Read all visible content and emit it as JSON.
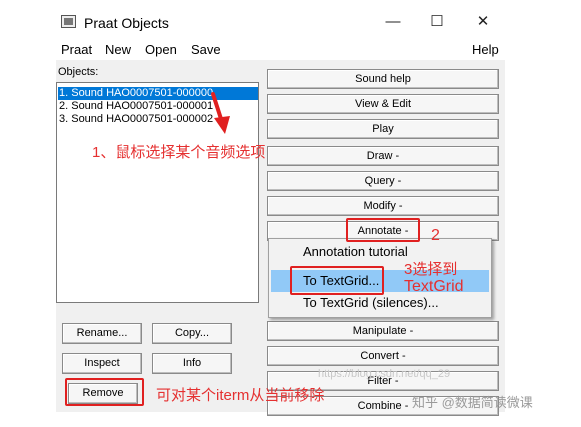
{
  "window": {
    "title": "Praat Objects",
    "minimize_glyph": "—",
    "maximize_glyph": "☐",
    "close_glyph": "✕"
  },
  "menu": {
    "praat": "Praat",
    "new": "New",
    "open": "Open",
    "save": "Save",
    "help": "Help"
  },
  "objects": {
    "label": "Objects:",
    "items": [
      {
        "label": "1. Sound HAO0007501-000000",
        "selected": true
      },
      {
        "label": "2. Sound HAO0007501-000001",
        "selected": false
      },
      {
        "label": "3. Sound HAO0007501-000002",
        "selected": false
      }
    ]
  },
  "right_buttons": {
    "sound_help": "Sound help",
    "view_edit": "View & Edit",
    "play": "Play",
    "draw": "Draw -",
    "query": "Query -",
    "modify": "Modify -",
    "annotate": "Annotate -",
    "manipulate": "Manipulate -",
    "convert": "Convert -",
    "filter": "Filter -",
    "combine": "Combine -"
  },
  "left_buttons": {
    "rename": "Rename...",
    "copy": "Copy...",
    "inspect": "Inspect",
    "info": "Info",
    "remove": "Remove"
  },
  "annotate_menu": {
    "items": [
      "Annotation tutorial",
      "To TextGrid...",
      "To TextGrid (silences)..."
    ]
  },
  "annotations": {
    "step1": "1、鼠标选择某个音频选项",
    "step2": "2",
    "step3_line1": "3选择到",
    "step3_line2": "TextGrid",
    "remove_note": "可对某个iterm从当前移除"
  },
  "watermark": {
    "csdn": "https://blog.csdn.net/qq_29",
    "zhihu": "知乎 @数据简读微课"
  },
  "colors": {
    "selection": "#0078d7",
    "menu_highlight": "#91c9f7",
    "annotation_red": "#e02020"
  }
}
